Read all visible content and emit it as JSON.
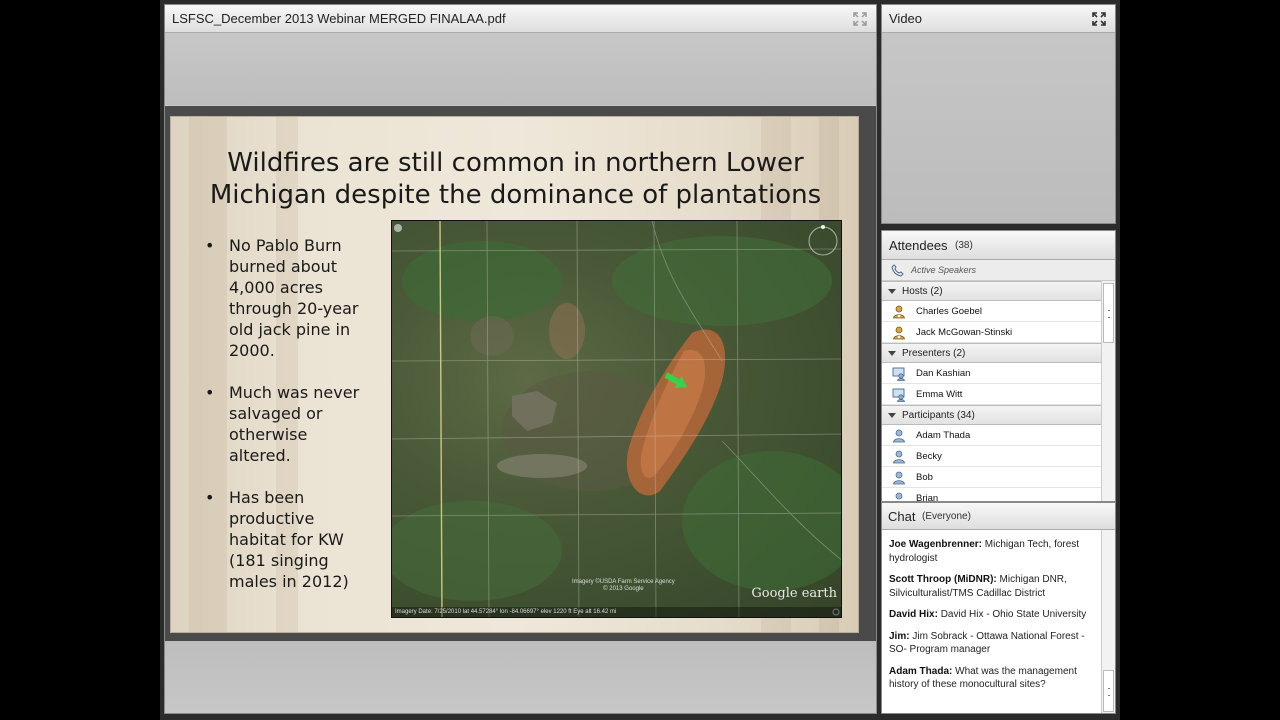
{
  "share_pod": {
    "title": "LSFSC_December 2013 Webinar MERGED FINALAA.pdf",
    "fullscreen_icon": "expand-icon"
  },
  "slide": {
    "title_line1": "Wildfires are still common in northern Lower",
    "title_line2": "Michigan despite the dominance of plantations",
    "bullets": [
      "No Pablo Burn burned about 4,000 acres through 20-year old jack pine in 2000.",
      "Much was never salvaged or otherwise altered.",
      "Has been productive habitat for KW (181 singing males in 2012)"
    ],
    "map": {
      "logo": "Google earth",
      "credit_line1": "Imagery ©USDA Farm Service Agency",
      "credit_line2": "© 2013 Google",
      "status": "Imagery Date: 7/25/2010          lat 44.57284°  lon -84.06697°  elev 1220 ft                                     Eye alt 16.42 mi"
    }
  },
  "video_pod": {
    "title": "Video",
    "icon": "fullscreen-icon"
  },
  "attendees": {
    "title": "Attendees",
    "count": "(38)",
    "active_speakers": "Active Speakers",
    "groups": {
      "hosts": {
        "label": "Hosts (2)",
        "members": [
          "Charles Goebel",
          "Jack McGowan-Stinski"
        ]
      },
      "presenters": {
        "label": "Presenters (2)",
        "members": [
          "Dan Kashian",
          "Emma Witt"
        ]
      },
      "participants": {
        "label": "Participants (34)",
        "members": [
          "Adam Thada",
          "Becky",
          "Bob",
          "Brian"
        ]
      }
    }
  },
  "chat": {
    "title": "Chat",
    "audience": "(Everyone)",
    "messages": [
      {
        "sender": "Joe Wagenbrenner:",
        "text": "Michigan Tech, forest hydrologist"
      },
      {
        "sender": "Scott Throop (MiDNR):",
        "text": "Michigan DNR, Silviculturalist/TMS Cadillac District"
      },
      {
        "sender": "David Hix:",
        "text": "David Hix - Ohio State University"
      },
      {
        "sender": "Jim:",
        "text": "Jim Sobrack - Ottawa National Forest -SO- Program manager"
      },
      {
        "sender": "Adam Thada:",
        "text": "What was the management history of these monocultural sites?"
      }
    ]
  }
}
